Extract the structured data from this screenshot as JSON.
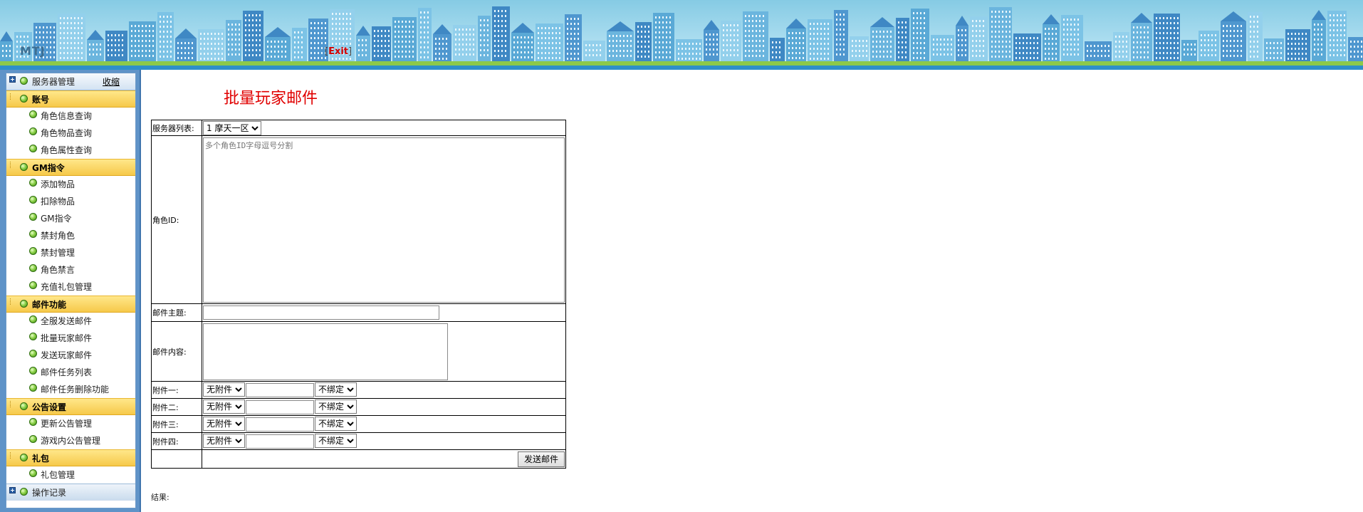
{
  "header": {
    "logo": "MTJ",
    "exit_open": "[",
    "exit_label": "Exit",
    "exit_close": "]",
    "colors": {
      "sky": "#a9dcef",
      "grass": "#8cc94a",
      "bar": "#2e8fc9"
    }
  },
  "sidebar": {
    "top_group": {
      "label": "服务器管理",
      "collapse_label": "收缩"
    },
    "groups": [
      {
        "label": "账号",
        "items": [
          "角色信息查询",
          "角色物品查询",
          "角色属性查询"
        ]
      },
      {
        "label": "GM指令",
        "items": [
          "添加物品",
          "扣除物品",
          "GM指令",
          "禁封角色",
          "禁封管理",
          "角色禁言",
          "充值礼包管理"
        ]
      },
      {
        "label": "邮件功能",
        "items": [
          "全服发送邮件",
          "批量玩家邮件",
          "发送玩家邮件",
          "邮件任务列表",
          "邮件任务删除功能"
        ]
      },
      {
        "label": "公告设置",
        "items": [
          "更新公告管理",
          "游戏内公告管理"
        ]
      },
      {
        "label": "礼包",
        "items": [
          "礼包管理"
        ]
      }
    ],
    "bottom_group": {
      "label": "操作记录"
    }
  },
  "main": {
    "title": "批量玩家邮件",
    "form": {
      "server_label": "服务器列表:",
      "server_selected": "1 摩天一区",
      "role_id_label": "角色ID:",
      "role_id_placeholder": "多个角色ID字母逗号分割",
      "subject_label": "邮件主题:",
      "subject_value": "",
      "content_label": "邮件内容:",
      "content_value": "",
      "attachments": [
        {
          "label": "附件一:",
          "type": "无附件",
          "bind": "不绑定"
        },
        {
          "label": "附件二:",
          "type": "无附件",
          "bind": "不绑定"
        },
        {
          "label": "附件三:",
          "type": "无附件",
          "bind": "不绑定"
        },
        {
          "label": "附件四:",
          "type": "无附件",
          "bind": "不绑定"
        }
      ],
      "send_label": "发送邮件"
    },
    "result_label": "结果:"
  }
}
